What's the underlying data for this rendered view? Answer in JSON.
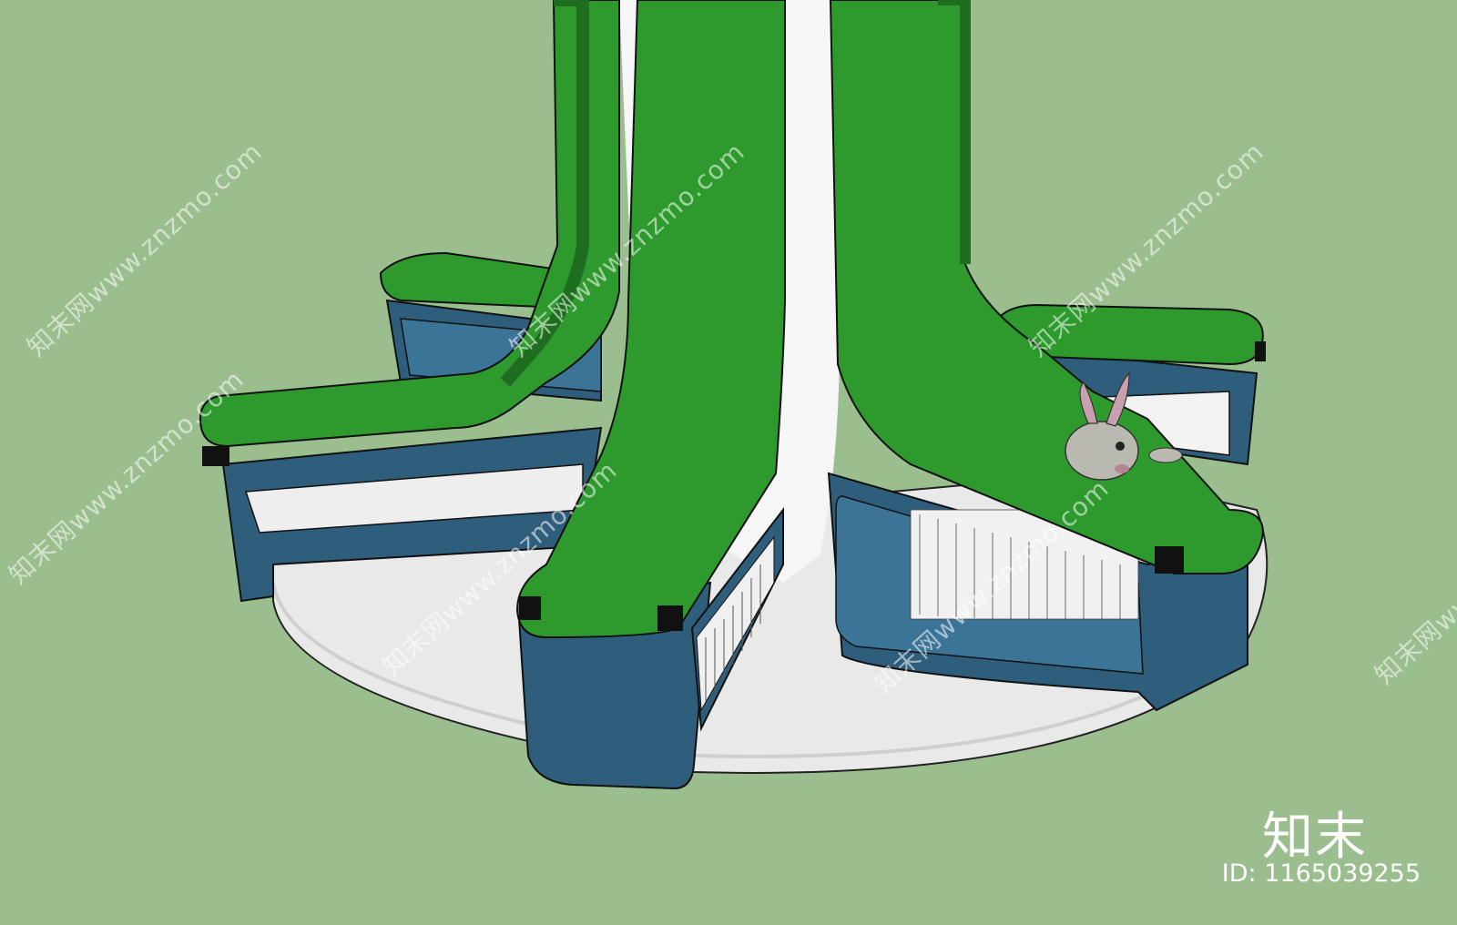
{
  "colors": {
    "background": "#9bbe8f",
    "seat_green": "#2e9a2e",
    "seat_shadow": "#1f6e1f",
    "cabinet_blue": "#2f5e7c",
    "cabinet_blue_light": "#3b7497",
    "platform": "#ededed",
    "column": "#f4f4f4"
  },
  "watermark": {
    "text": "知末网www.znzmo.com"
  },
  "brand": {
    "logo": "知末",
    "id_text": "ID: 1165039255"
  },
  "scene": {
    "description_icons": [
      "seat-icon",
      "bookshelf-icon",
      "plush-rabbit-icon"
    ]
  }
}
